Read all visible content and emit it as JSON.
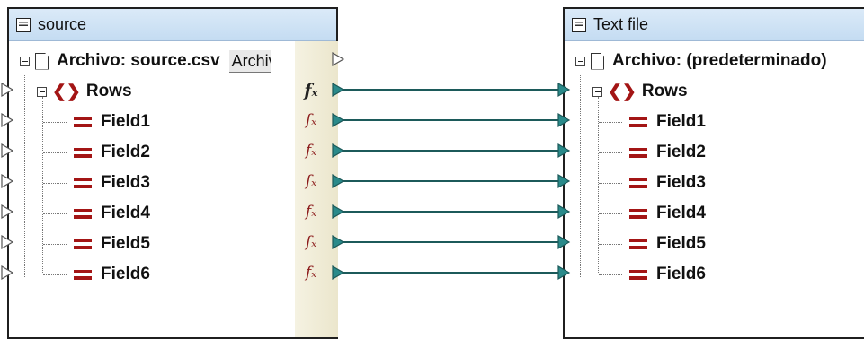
{
  "left_component": {
    "title": "source",
    "file_label": "Archivo: source.csv",
    "encoding_field": "Archivo",
    "rows_label": "Rows",
    "fields": [
      "Field1",
      "Field2",
      "Field3",
      "Field4",
      "Field5",
      "Field6"
    ]
  },
  "right_component": {
    "title": "Text file",
    "file_label": "Archivo: (predeterminado)",
    "rows_label": "Rows",
    "fields": [
      "Field1",
      "Field2",
      "Field3",
      "Field4",
      "Field5",
      "Field6"
    ]
  },
  "colors": {
    "connector": "#1c5a5a",
    "handle_fill": "#2a8a8a",
    "element_icon": "#a31515"
  },
  "icons": {
    "component_title": "component-list-icon",
    "file": "document-icon",
    "rows": "braces-icon",
    "field": "field-icon",
    "function": "function-fx-icon"
  }
}
